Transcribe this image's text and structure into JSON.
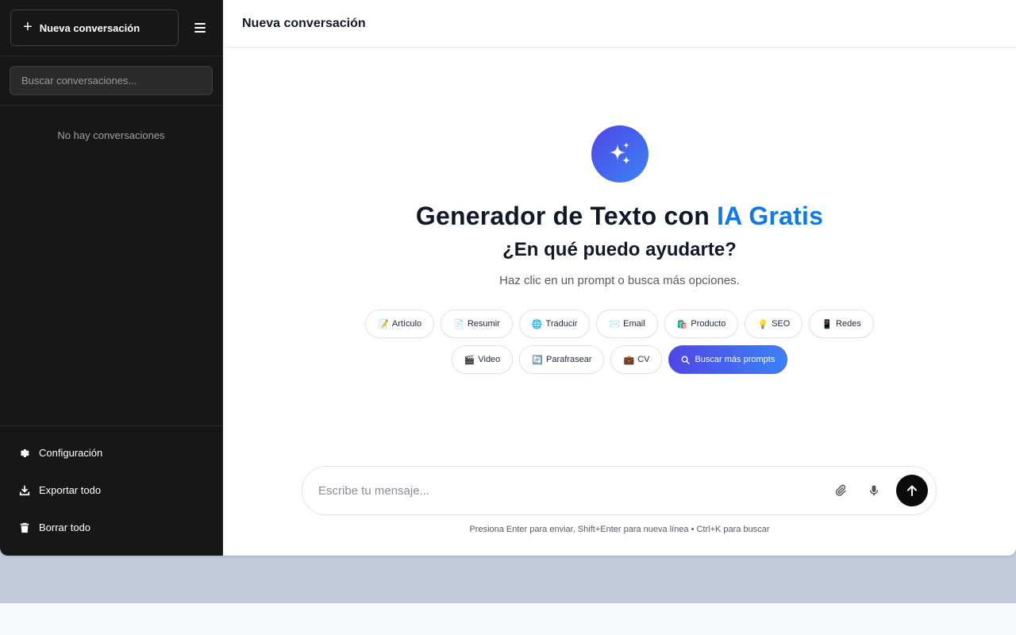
{
  "sidebar": {
    "new_conversation_label": "Nueva conversación",
    "search_placeholder": "Buscar conversaciones...",
    "empty_text": "No hay conversaciones",
    "bottom_items": [
      {
        "label": "Configuración",
        "icon": "gear-icon"
      },
      {
        "label": "Exportar todo",
        "icon": "download-icon"
      },
      {
        "label": "Borrar todo",
        "icon": "trash-icon"
      }
    ]
  },
  "header": {
    "title": "Nueva conversación"
  },
  "hero": {
    "icon": "sparkles-icon",
    "title_main": "Generador de Texto con ",
    "title_accent": "IA Gratis",
    "subtitle": "¿En qué puedo ayudarte?",
    "hint": "Haz clic en un prompt o busca más opciones."
  },
  "chips": [
    {
      "emoji": "📝",
      "label": "Artículo"
    },
    {
      "emoji": "📄",
      "label": "Resumir"
    },
    {
      "emoji": "🌐",
      "label": "Traducir"
    },
    {
      "emoji": "✉️",
      "label": "Email"
    },
    {
      "emoji": "🛍️",
      "label": "Producto"
    },
    {
      "emoji": "💡",
      "label": "SEO"
    },
    {
      "emoji": "📱",
      "label": "Redes"
    },
    {
      "emoji": "🎬",
      "label": "Video"
    },
    {
      "emoji": "🔄",
      "label": "Parafrasear"
    },
    {
      "emoji": "💼",
      "label": "CV"
    }
  ],
  "search_prompts_label": "Buscar más prompts",
  "composer": {
    "placeholder": "Escribe tu mensaje...",
    "hint": "Presiona Enter para enviar, Shift+Enter para nueva línea • Ctrl+K para buscar"
  },
  "colors": {
    "sidebar_bg": "#171717",
    "accent_blue": "#0f7ae5",
    "gradient_start": "#4f46e5",
    "gradient_end": "#3b82f6",
    "page_bg": "#c3cadc"
  }
}
